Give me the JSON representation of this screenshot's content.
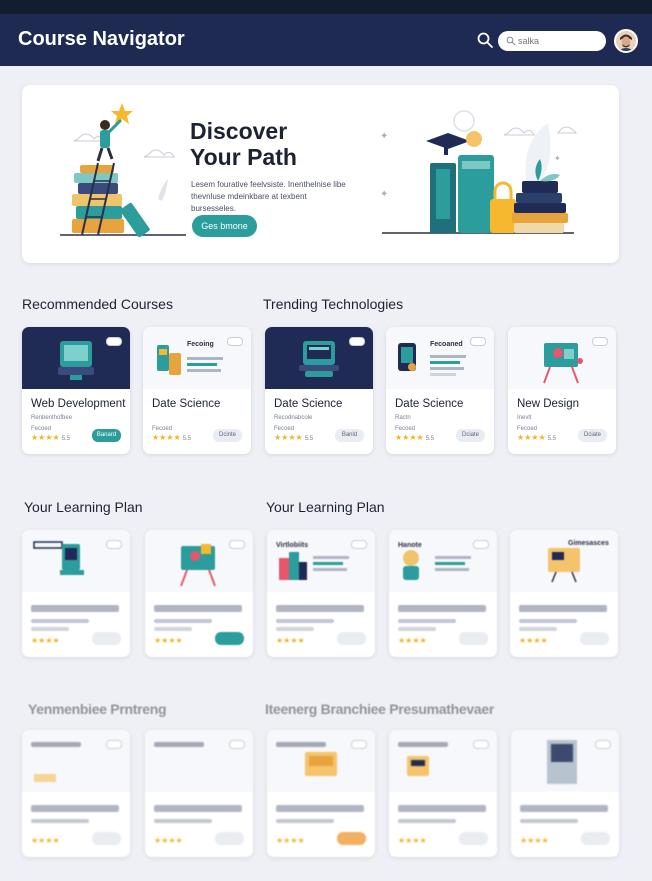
{
  "app": {
    "title": "Course Navigator"
  },
  "search": {
    "placeholder": "salka"
  },
  "hero": {
    "title": "Discover\nYour Path",
    "description": "Lesem fourative feelvsiste. Inenthelnise libe thevnluse mdeinkbare at texbent bursesseles.",
    "cta_label": "Ges bmone"
  },
  "sections": [
    {
      "title": "Recommended Courses",
      "cards": [
        {
          "title": "Web Development",
          "subtitle": "Renbenthofbee",
          "meta": "Fecoed",
          "rating": "★★★★",
          "rating_text": "5.5",
          "button": "Banard",
          "button_style": "teal",
          "thumb": "dark",
          "thumb_icon": "monitor-icon"
        },
        {
          "title": "Date Science",
          "subtitle": "",
          "meta": "Fecoed",
          "rating": "★★★★",
          "rating_text": "5.5",
          "button": "Dcinte",
          "button_style": "gray",
          "thumb": "light",
          "thumb_icon": "analytics-icon",
          "thumb_head": "Fecoing"
        }
      ]
    },
    {
      "title": "Trending Technologies",
      "cards": [
        {
          "title": "Date Science",
          "subtitle": "Recodnabcole",
          "meta": "Fecoed",
          "rating": "★★★★",
          "rating_text": "5.5",
          "button": "Banld",
          "button_style": "gray",
          "thumb": "dark",
          "thumb_icon": "laptop-icon"
        },
        {
          "title": "Date Science",
          "subtitle": "Ractn",
          "meta": "Fecoed",
          "rating": "★★★★",
          "rating_text": "5.5",
          "button": "Dciate",
          "button_style": "gray",
          "thumb": "light",
          "thumb_icon": "tablet-icon",
          "thumb_head": "Fecoaned"
        },
        {
          "title": "New Design",
          "subtitle": "Inevlt",
          "meta": "Fecoed",
          "rating": "★★★★",
          "rating_text": "5.5",
          "button": "Dciate",
          "button_style": "gray",
          "thumb": "light",
          "thumb_icon": "easel-icon"
        }
      ]
    },
    {
      "title": "Your Learning Plan"
    },
    {
      "title": "Your Learning Plan"
    },
    {
      "title": "Yenmenbiee Prntreng"
    },
    {
      "title": "Iteenerg Branchiee Presumathevaer"
    }
  ],
  "plan_cards": [
    {
      "thumb_head": "",
      "button_style": "gray"
    },
    {
      "thumb_head": "",
      "button_style": "teal"
    },
    {
      "thumb_head": "Virtlobiits",
      "button_style": "gray"
    },
    {
      "thumb_head": "Hanote",
      "button_style": "gray"
    },
    {
      "thumb_head": "Gimesasces",
      "button_style": "gray"
    }
  ],
  "bottom_cards": [
    {
      "button_style": "gray"
    },
    {
      "button_style": "gray"
    },
    {
      "button_style": "orange"
    },
    {
      "button_style": "gray"
    },
    {
      "button_style": "gray"
    }
  ],
  "colors": {
    "navbar": "#1e2a52",
    "accent_teal": "#2a9d9c",
    "star": "#f0b429",
    "accent_orange": "#f3b061"
  }
}
